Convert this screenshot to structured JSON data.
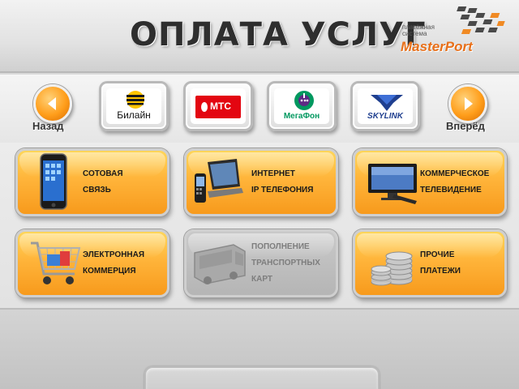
{
  "header": {
    "title": "ОПЛАТА УСЛУГ",
    "logo": {
      "subtitle": "платёжная система",
      "name": "MasterPort"
    }
  },
  "nav": {
    "back_label": "Назад",
    "forward_label": "Вперёд",
    "back_icon": "chevron-left-icon",
    "forward_icon": "chevron-right-icon"
  },
  "operators": [
    {
      "label": "Билайн",
      "icon": "beeline-logo-icon"
    },
    {
      "label": "МТС",
      "icon": "mts-logo-icon"
    },
    {
      "label": "МегаФон",
      "icon": "megafon-logo-icon"
    },
    {
      "label": "SKYLINK",
      "icon": "skylink-logo-icon"
    }
  ],
  "services": [
    {
      "lines": [
        "СОТОВАЯ",
        "СВЯЗЬ"
      ],
      "icon": "mobile-phone-icon",
      "enabled": true
    },
    {
      "lines": [
        "ИНТЕРНЕТ",
        "IP ТЕЛЕФОНИЯ"
      ],
      "icon": "laptop-phone-icon",
      "enabled": true
    },
    {
      "lines": [
        "КОММЕРЧЕСКОЕ",
        "ТЕЛЕВИДЕНИЕ"
      ],
      "icon": "tv-icon",
      "enabled": true
    },
    {
      "lines": [
        "ЭЛЕКТРОННАЯ",
        "КОММЕРЦИЯ"
      ],
      "icon": "shopping-cart-icon",
      "enabled": true
    },
    {
      "lines": [
        "ПОПОЛНЕНИЕ",
        "ТРАНСПОРТНЫХ",
        "КАРТ"
      ],
      "icon": "bus-icon",
      "enabled": false
    },
    {
      "lines": [
        "ПРОЧИЕ",
        "ПЛАТЕЖИ"
      ],
      "icon": "coins-icon",
      "enabled": true
    }
  ],
  "colors": {
    "accent_orange": "#f79a1c",
    "mts_red": "#e30611",
    "megafon_green": "#00985f",
    "skylink_blue": "#1f3f8f",
    "beeline_yellow": "#ffc400"
  }
}
